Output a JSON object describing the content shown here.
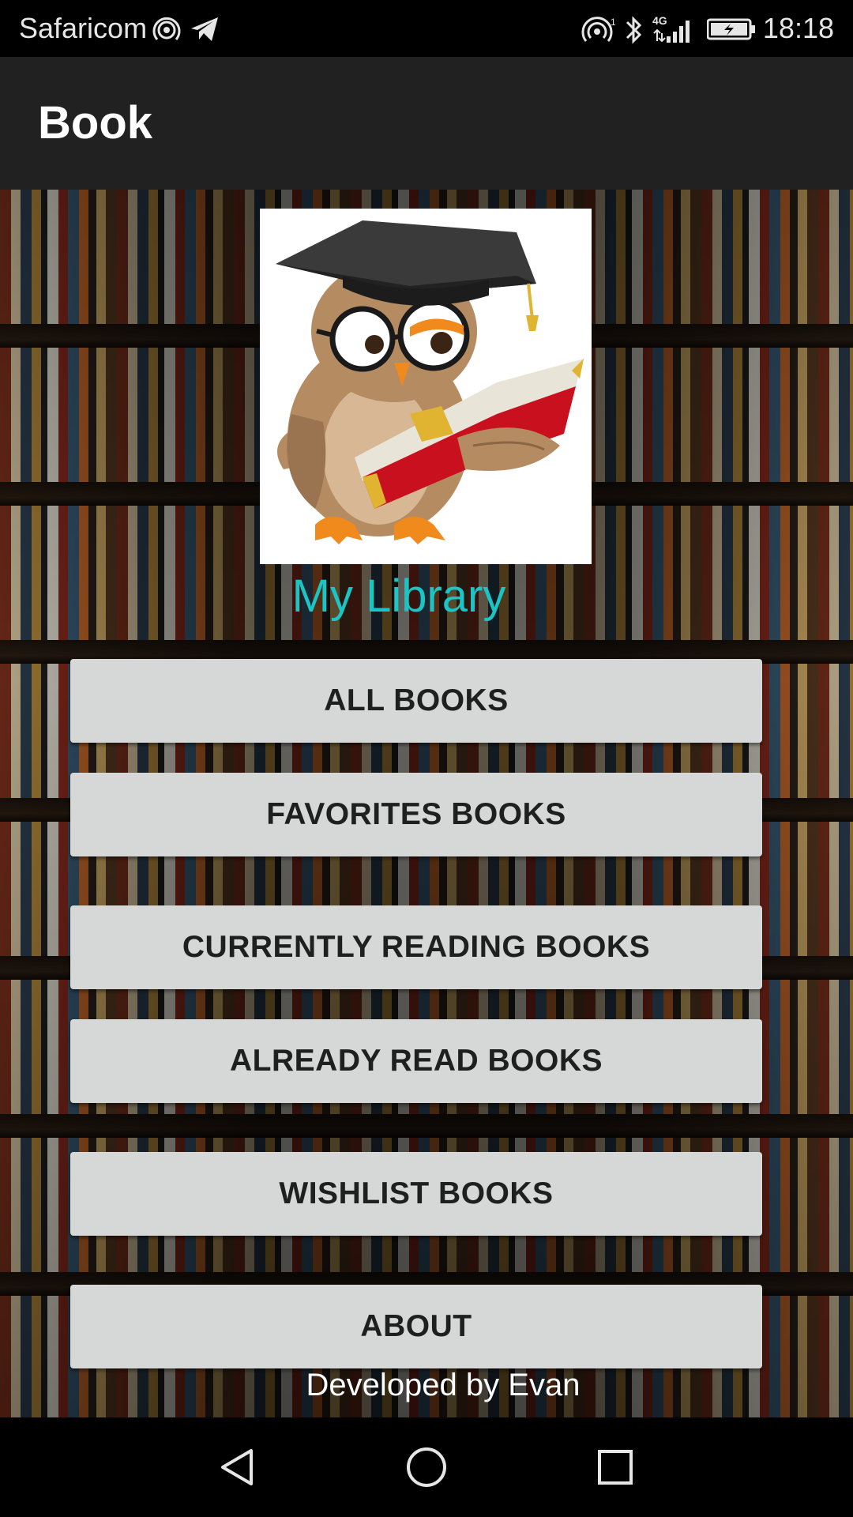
{
  "status_bar": {
    "carrier": "Safaricom",
    "network_label": "4G",
    "time": "18:18"
  },
  "app_bar": {
    "title": "Book"
  },
  "main": {
    "logo_icon": "owl-reading-book-icon",
    "title": "My Library",
    "buttons": [
      {
        "label": "ALL BOOKS"
      },
      {
        "label": "FAVORITES BOOKS"
      },
      {
        "label": "CURRENTLY READING BOOKS"
      },
      {
        "label": "ALREADY READ BOOKS"
      },
      {
        "label": "WISHLIST BOOKS"
      },
      {
        "label": "ABOUT"
      }
    ],
    "footer": "Developed by Evan"
  },
  "nav_bar": {
    "icons": [
      "back-icon",
      "home-icon",
      "recents-icon"
    ]
  },
  "colors": {
    "app_bar": "#212121",
    "title_accent": "#1cc4c4",
    "button_bg": "#d6d7d7",
    "button_text": "#1f1f1f"
  }
}
